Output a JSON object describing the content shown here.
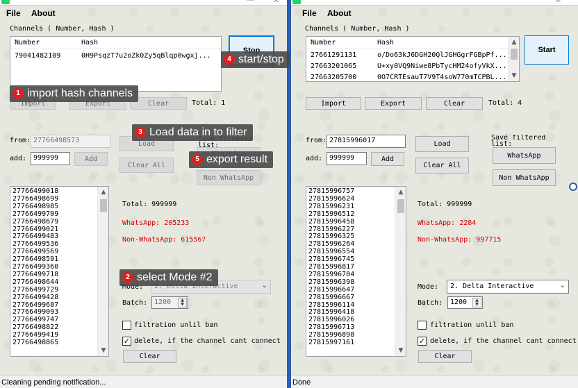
{
  "menu": {
    "file": "File",
    "about": "About"
  },
  "channels_label": "Channels ( Number, Hash )",
  "table_headers": {
    "number": "Number",
    "hash": "Hash"
  },
  "left": {
    "channels": [
      {
        "number": "79041482109",
        "hash": "0H9PsqzT7u2oZk0Zy5qBlqp0wgxj..."
      }
    ],
    "stop_button": "Stop",
    "import_button": "Import",
    "export_button": "Export",
    "clear_button": "Clear",
    "total_channels": "Total: 1",
    "from_label": "from:",
    "from_value": "27766498573",
    "add_label": "add:",
    "add_value": "999999",
    "add_button": "Add",
    "load_button": "Load",
    "clear_all_button": "Clear All",
    "save_filtered_label": "Save filtered list:",
    "whatsapp_button": "WhatsApp",
    "non_whatsapp_button": "Non WhatsApp",
    "numbers": [
      "27766499018",
      "27766498699",
      "27766498985",
      "27766499709",
      "27766498679",
      "27766499021",
      "27766499483",
      "27766499536",
      "27766499569",
      "27766498591",
      "27766499360",
      "27766499718",
      "27766498644",
      "27766499729",
      "27766499428",
      "27766499687",
      "27766499093",
      "27766499747",
      "27766498822",
      "27766499419",
      "27766498865"
    ],
    "total": "Total: 999999",
    "whatsapp_count": "WhatsApp: 205233",
    "non_whatsapp_count": "Non-WhatsApp: 615567",
    "mode_label": "Mode:",
    "mode_value": "2. Delta Interactive",
    "batch_label": "Batch:",
    "batch_value": "1200",
    "filtration_label": "filtration unlil ban",
    "delete_label": "delete, if the channel cant connect",
    "bottom_clear_button": "Clear",
    "status": "Cleaning pending notification..."
  },
  "right": {
    "channels": [
      {
        "number": "27661291131",
        "hash": "o/Do63kJ6DGH20QlJGHGgrFGBpPf..."
      },
      {
        "number": "27663201065",
        "hash": "U+xy0VQ9Niwe8PbTycHM24ofyVkX..."
      },
      {
        "number": "27663205700",
        "hash": "0O7CRTEsauT7V9T4soW770mTCPBL..."
      }
    ],
    "start_button": "Start",
    "import_button": "Import",
    "export_button": "Export",
    "clear_button": "Clear",
    "total_channels": "Total: 4",
    "from_label": "from:",
    "from_value": "27815996017",
    "add_label": "add:",
    "add_value": "999999",
    "add_button": "Add",
    "load_button": "Load",
    "clear_all_button": "Clear All",
    "save_filtered_label": "Save filtered list:",
    "whatsapp_button": "WhatsApp",
    "non_whatsapp_button": "Non WhatsApp",
    "numbers": [
      "27815996757",
      "27815996624",
      "27815996231",
      "27815996512",
      "27815996458",
      "27815996227",
      "27815996325",
      "27815996264",
      "27815996554",
      "27815996745",
      "27815996817",
      "27815996704",
      "27815996398",
      "27815996647",
      "27815996667",
      "27815996114",
      "27815996418",
      "27815996026",
      "27815996713",
      "27815996898",
      "27815997161"
    ],
    "total": "Total: 999999",
    "whatsapp_count": "WhatsApp: 2284",
    "non_whatsapp_count": "Non-WhatsApp: 997715",
    "mode_label": "Mode:",
    "mode_value": "2. Delta Interactive",
    "batch_label": "Batch:",
    "batch_value": "1200",
    "filtration_label": "filtration unlil ban",
    "delete_label": "delete, if the channel cant connect",
    "bottom_clear_button": "Clear",
    "status": "Done"
  },
  "annotations": {
    "a1": {
      "num": "1",
      "text": "import hash channels"
    },
    "a2": {
      "num": "2",
      "text": "select Mode #2"
    },
    "a3": {
      "num": "3",
      "text": "Load data in to filter"
    },
    "a4": {
      "num": "4",
      "text": "start/stop"
    },
    "a5": {
      "num": "5",
      "text": "export result"
    }
  },
  "colors": {
    "accent": "#0078d7",
    "divider": "#2b5fb4",
    "red_text": "#d00000",
    "callout_badge": "#e02020"
  }
}
